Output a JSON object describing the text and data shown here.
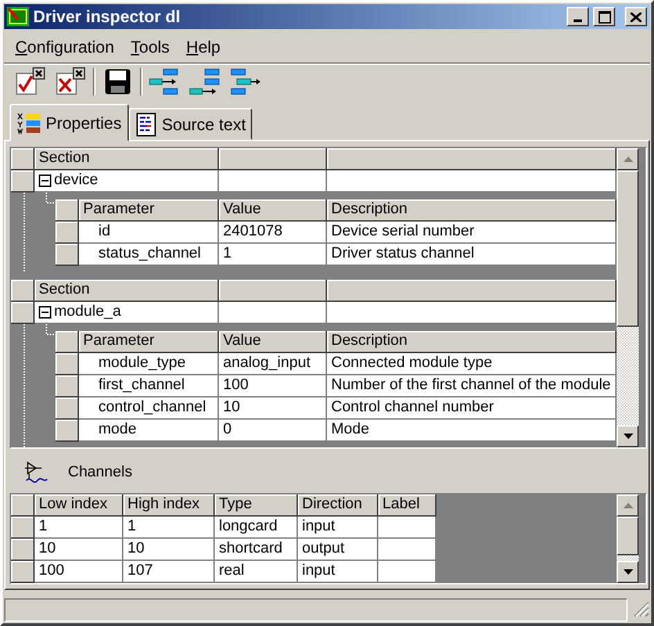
{
  "window": {
    "title": "Driver inspector dl"
  },
  "menu": [
    {
      "mnemonic": "C",
      "rest": "onfiguration"
    },
    {
      "mnemonic": "T",
      "rest": "ools"
    },
    {
      "mnemonic": "H",
      "rest": "elp"
    }
  ],
  "tabs": [
    {
      "label": "Properties",
      "kind": "properties",
      "selected": true
    },
    {
      "label": "Source text",
      "kind": "source",
      "selected": false
    }
  ],
  "sections": [
    {
      "header": "Section",
      "name": "device",
      "expanded": true,
      "columns": [
        "Parameter",
        "Value",
        "Description"
      ],
      "parameters": [
        {
          "parameter": "id",
          "value": "2401078",
          "description": "Device serial number"
        },
        {
          "parameter": "status_channel",
          "value": "1",
          "description": "Driver status channel"
        }
      ]
    },
    {
      "header": "Section",
      "name": "module_a",
      "expanded": true,
      "columns": [
        "Parameter",
        "Value",
        "Description"
      ],
      "parameters": [
        {
          "parameter": "module_type",
          "value": "analog_input",
          "description": "Connected module type"
        },
        {
          "parameter": "first_channel",
          "value": "100",
          "description": "Number of the first channel of the module"
        },
        {
          "parameter": "control_channel",
          "value": "10",
          "description": "Control channel number"
        },
        {
          "parameter": "mode",
          "value": "0",
          "description": "Mode"
        }
      ]
    }
  ],
  "channels": {
    "title": "Channels",
    "columns": [
      "Low index",
      "High index",
      "Type",
      "Direction",
      "Label"
    ],
    "rows": [
      {
        "low_index": "1",
        "high_index": "1",
        "type": "longcard",
        "direction": "input"
      },
      {
        "low_index": "10",
        "high_index": "10",
        "type": "shortcard",
        "direction": "output"
      },
      {
        "low_index": "100",
        "high_index": "107",
        "type": "real",
        "direction": "input"
      }
    ]
  }
}
